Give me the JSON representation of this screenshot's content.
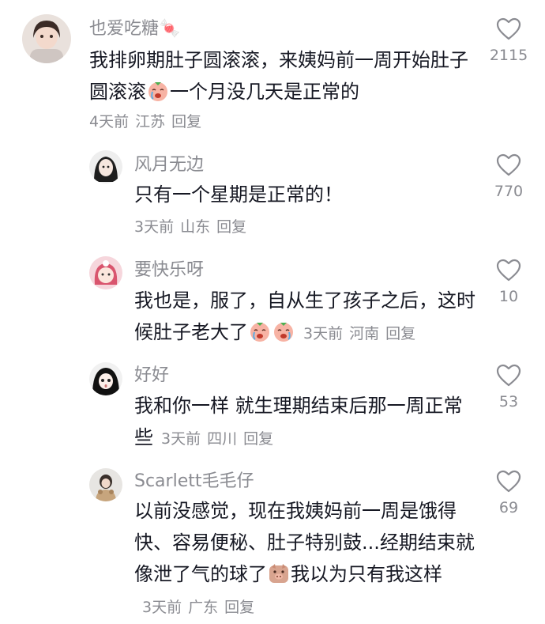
{
  "comments": [
    {
      "username": "也爱吃糖🍬",
      "text_before": "我排卵期肚子圆滚滚，来姨妈前一周开始肚子圆滚滚",
      "text_after": "一个月没几天是正常的",
      "time": "4天前",
      "location": "江苏",
      "reply": "回复",
      "likes": "2115"
    },
    {
      "username": "风月无边",
      "text": "只有一个星期是正常的！",
      "time": "3天前",
      "location": "山东",
      "reply": "回复",
      "likes": "770"
    },
    {
      "username": "要快乐呀",
      "text_before": "我也是，服了，自从生了孩子之后，这时候肚子老大了",
      "time": "3天前",
      "location": "河南",
      "reply": "回复",
      "likes": "10"
    },
    {
      "username": "好好",
      "text": "我和你一样 就生理期结束后那一周正常些",
      "time": "3天前",
      "location": "四川",
      "reply": "回复",
      "likes": "53"
    },
    {
      "username": "Scarlett毛毛仔",
      "text_before": "以前没感觉，现在我姨妈前一周是饿得快、容易便秘、肚子特别鼓...经期结束就像泄了气的球了",
      "text_after": "我以为只有我这样",
      "time": "3天前",
      "location": "广东",
      "reply": "回复",
      "likes": "69"
    }
  ],
  "icons": {
    "like": "heart-outline-icon",
    "crying_emoji": "crying-face-emoji",
    "piggy_emoji": "pig-face-emoji"
  },
  "colors": {
    "text_primary": "#161823",
    "text_secondary": "#8a8b91"
  }
}
